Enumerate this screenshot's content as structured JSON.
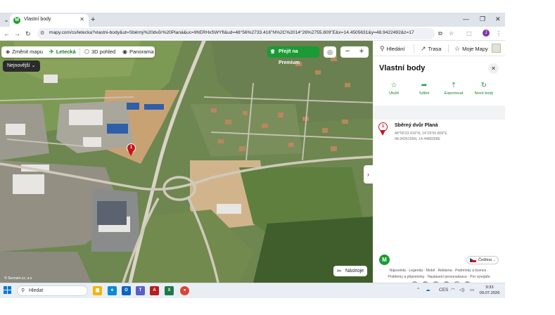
{
  "browser": {
    "tab_title": "Vlastní body",
    "favicon_letter": "M",
    "url": "mapy.com/cs/letecka?vlastni-body&ut=Sběrný%20dvůr%20Planá&uc=9hERHxSWYfl&ud=48°56%2733.416\"N%2C%2014°26%2755.809\"E&x=14.4505631&y=48.9422492&z=17",
    "profile_letter": "J"
  },
  "map": {
    "change_map_label": "Změnit mapu",
    "aerial_label": "Letecká",
    "view3d_label": "3D pohled",
    "panorama_label": "Panorama",
    "premium_label": "Přejít na Premium",
    "sort_label": "Nejnovější",
    "pin_number": "1",
    "tools_label": "Nástroje",
    "zoom_out": "−",
    "zoom_in": "+"
  },
  "panel": {
    "top_nav": [
      "Hledání",
      "Trasa",
      "Moje Mapy"
    ],
    "title": "Vlastní body",
    "actions": [
      {
        "label": "Uložit",
        "icon": "star-icon"
      },
      {
        "label": "Sdílet",
        "icon": "share-icon"
      },
      {
        "label": "Exportovat",
        "icon": "export-icon"
      },
      {
        "label": "Nové body",
        "icon": "refresh-icon"
      }
    ],
    "place": {
      "number": "1",
      "name": "Sběrný dvůr Planá",
      "dms": "48°56'33.416\"N, 14°26'55.809\"E",
      "decimal": "48.9426156N, 14.4488358E"
    },
    "language": "Čeština",
    "footer_links_1": "Nápověda · Legenda · Mobil · Reklama · Podmínky a licence ·",
    "footer_links_2": "Problémy a připomínky · Nastavení personalizace · Pro vývojáře"
  },
  "taskbar": {
    "search_placeholder": "Hledat",
    "language_indicator": "CES",
    "time": "9:33",
    "date": "09.07.2026"
  },
  "colors": {
    "brand_green": "#1a9b35",
    "pin_red": "#c4141b",
    "tab_bar": "#dfe3ea"
  }
}
